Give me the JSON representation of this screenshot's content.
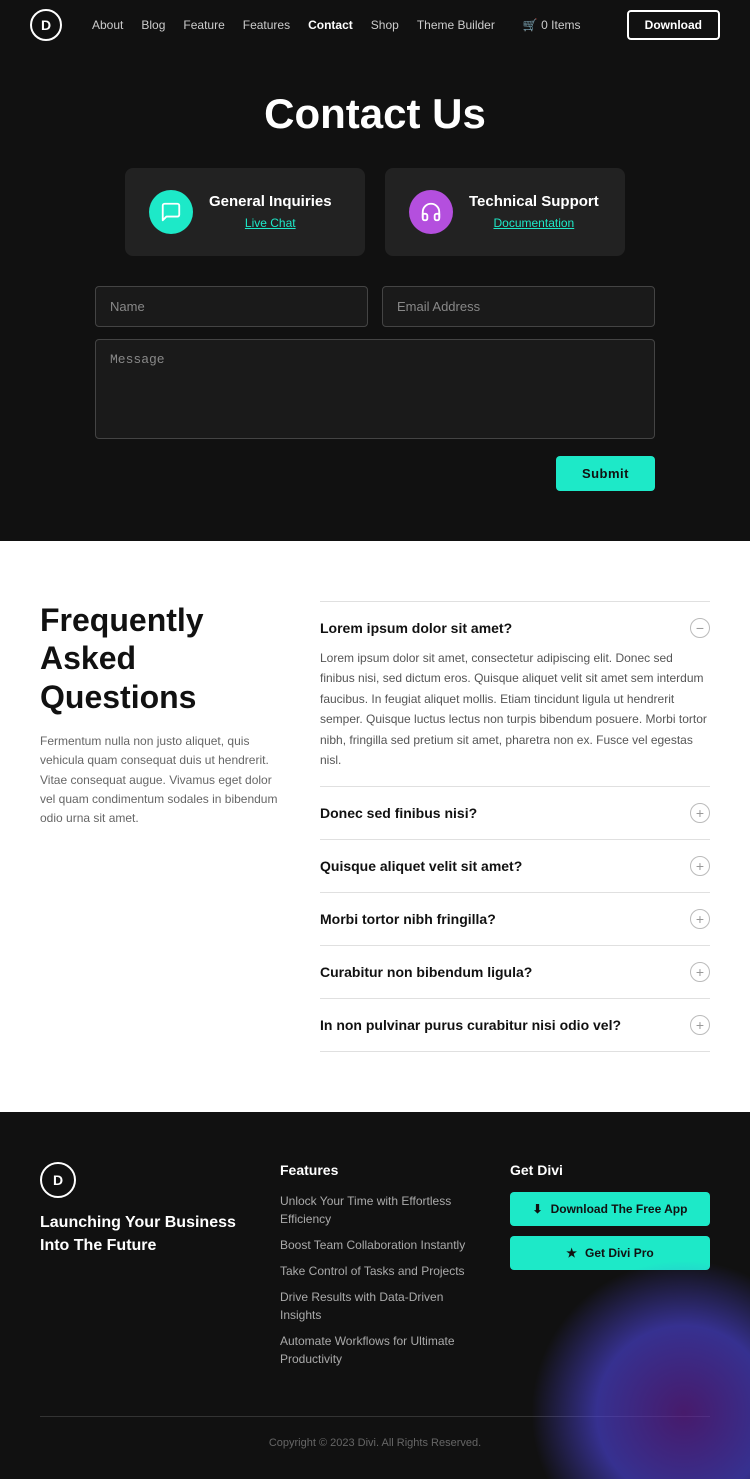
{
  "nav": {
    "logo": "D",
    "links": [
      {
        "label": "About",
        "active": false
      },
      {
        "label": "Blog",
        "active": false
      },
      {
        "label": "Feature",
        "active": false
      },
      {
        "label": "Features",
        "active": false
      },
      {
        "label": "Contact",
        "active": true
      },
      {
        "label": "Shop",
        "active": false
      },
      {
        "label": "Theme Builder",
        "active": false
      }
    ],
    "cart": "0 Items",
    "download": "Download"
  },
  "hero": {
    "title": "Contact Us"
  },
  "cards": [
    {
      "icon_type": "teal",
      "icon_symbol": "chat",
      "title": "General Inquiries",
      "link_label": "Live Chat"
    },
    {
      "icon_type": "purple",
      "icon_symbol": "headphone",
      "title": "Technical Support",
      "link_label": "Documentation"
    }
  ],
  "form": {
    "name_placeholder": "Name",
    "email_placeholder": "Email Address",
    "message_placeholder": "Message",
    "submit_label": "Submit"
  },
  "faq": {
    "heading": "Frequently Asked Questions",
    "description": "Fermentum nulla non justo aliquet, quis vehicula quam consequat duis ut hendrerit. Vitae consequat augue. Vivamus eget dolor vel quam condimentum sodales in bibendum odio urna sit amet.",
    "items": [
      {
        "question": "Lorem ipsum dolor sit amet?",
        "answer": "Lorem ipsum dolor sit amet, consectetur adipiscing elit. Donec sed finibus nisi, sed dictum eros. Quisque aliquet velit sit amet sem interdum faucibus. In feugiat aliquet mollis. Etiam tincidunt ligula ut hendrerit semper. Quisque luctus lectus non turpis bibendum posuere. Morbi tortor nibh, fringilla sed pretium sit amet, pharetra non ex. Fusce vel egestas nisl.",
        "open": true
      },
      {
        "question": "Donec sed finibus nisi?",
        "answer": "",
        "open": false
      },
      {
        "question": "Quisque aliquet velit sit amet?",
        "answer": "",
        "open": false
      },
      {
        "question": "Morbi tortor nibh fringilla?",
        "answer": "",
        "open": false
      },
      {
        "question": "Curabitur non bibendum ligula?",
        "answer": "",
        "open": false
      },
      {
        "question": "In non pulvinar purus curabitur nisi odio vel?",
        "answer": "",
        "open": false
      }
    ]
  },
  "footer": {
    "logo": "D",
    "tagline": "Launching Your Business Into The Future",
    "features_heading": "Features",
    "features_links": [
      "Unlock Your Time with Effortless Efficiency",
      "Boost Team Collaboration Instantly",
      "Take Control of Tasks and Projects",
      "Drive Results with Data-Driven Insights",
      "Automate Workflows for Ultimate Productivity"
    ],
    "get_divi_heading": "Get Divi",
    "btn_download": "Download The Free App",
    "btn_pro": "Get Divi Pro",
    "copyright": "Copyright © 2023 Divi. All Rights Reserved."
  }
}
